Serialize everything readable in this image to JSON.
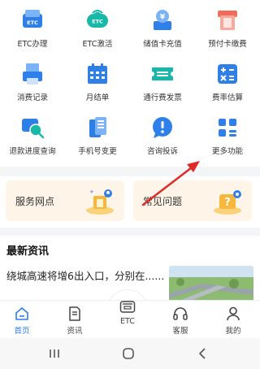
{
  "grid": {
    "items": [
      {
        "label": "ETC办理",
        "icon": "etc-card-icon",
        "badge": "ETC"
      },
      {
        "label": "ETC激活",
        "icon": "etc-activate-icon",
        "badge": "ETC"
      },
      {
        "label": "储值卡充值",
        "icon": "yuan-wallet-icon"
      },
      {
        "label": "预付卡缴费",
        "icon": "atm-card-icon"
      },
      {
        "label": "消费记录",
        "icon": "printer-receipt-icon"
      },
      {
        "label": "月结单",
        "icon": "calendar-icon"
      },
      {
        "label": "通行费发票",
        "icon": "ticket-icon"
      },
      {
        "label": "费率估算",
        "icon": "calculator-icon"
      },
      {
        "label": "退款进度查询",
        "icon": "search-chat-icon"
      },
      {
        "label": "手机号变更",
        "icon": "phone-change-icon"
      },
      {
        "label": "咨询投诉",
        "icon": "alert-chat-icon"
      },
      {
        "label": "更多功能",
        "icon": "more-grid-icon"
      }
    ]
  },
  "cards": [
    {
      "label": "服务网点",
      "icon": "service-point-illustration"
    },
    {
      "label": "常见问题",
      "icon": "faq-illustration"
    }
  ],
  "news": {
    "section_title": "最新资讯",
    "headline": "绕城高速将增6出入口，分别在......"
  },
  "tabbar": {
    "tabs": [
      {
        "label": "首页",
        "icon": "home-icon",
        "active": true
      },
      {
        "label": "资讯",
        "icon": "document-icon",
        "active": false
      },
      {
        "label": "ETC",
        "icon": "etc-device-icon",
        "active": false
      },
      {
        "label": "客服",
        "icon": "headset-icon",
        "active": false
      },
      {
        "label": "我的",
        "icon": "person-icon",
        "active": false
      }
    ]
  },
  "system_nav": {
    "buttons": [
      "recent-apps-icon",
      "home-circle-icon",
      "back-icon"
    ]
  },
  "colors": {
    "primary_blue": "#2f7fe8",
    "teal": "#18b8a8",
    "card_bg": "#fff4e8",
    "red_card": "#f26b5a",
    "arrow_red": "#e02a2a"
  }
}
